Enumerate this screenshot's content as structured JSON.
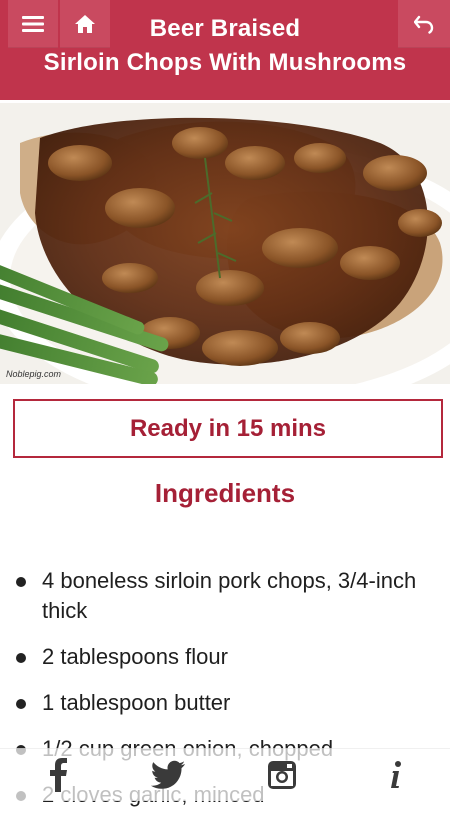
{
  "header": {
    "title_line1": "Beer Braised",
    "title_line2": "Sirloin Chops With Mushrooms",
    "color": "#c0344c"
  },
  "hero": {
    "watermark": "Noblepig.com"
  },
  "ready": {
    "label": "Ready in 15 mins"
  },
  "ingredients": {
    "heading": "Ingredients",
    "items": [
      "4 boneless sirloin pork chops, 3/4-inch thick",
      "2 tablespoons flour",
      "1 tablespoon butter",
      "1/2 cup green onion, chopped",
      "2 cloves garlic, minced"
    ]
  },
  "icons": {
    "menu": "hamburger-icon",
    "home": "home-icon",
    "back": "undo-icon",
    "facebook": "facebook-icon",
    "twitter": "twitter-icon",
    "instagram": "instagram-icon",
    "info": "info-icon"
  }
}
